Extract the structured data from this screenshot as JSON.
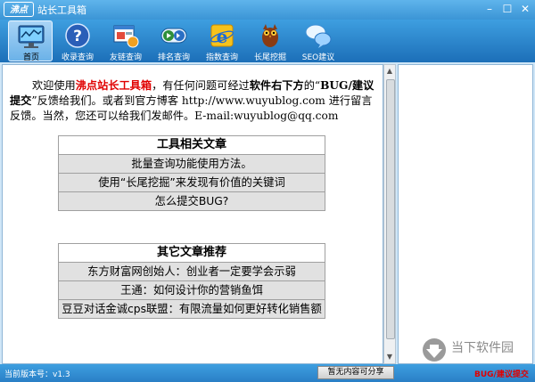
{
  "window": {
    "logo_text": "沸点",
    "title": "站长工具箱",
    "min_symbol": "–",
    "max_symbol": "☐",
    "close_symbol": "✕"
  },
  "toolbar": {
    "items": [
      {
        "label": "首页",
        "icon": "monitor-icon",
        "active": true
      },
      {
        "label": "收录查询",
        "icon": "help-icon",
        "active": false
      },
      {
        "label": "友链查询",
        "icon": "browser-window-icon",
        "active": false
      },
      {
        "label": "排名查询",
        "icon": "play-forward-icon",
        "active": false
      },
      {
        "label": "指数查询",
        "icon": "ie-icon",
        "active": false
      },
      {
        "label": "长尾挖掘",
        "icon": "owl-icon",
        "active": false
      },
      {
        "label": "SEO建议",
        "icon": "chat-bubbles-icon",
        "active": false
      }
    ]
  },
  "intro": {
    "p1": "欢迎使用",
    "brand": "沸点站长工具箱",
    "p2": "，有任何问题可经过",
    "bold1": "软件右下方",
    "p3": "的“",
    "bold2": "BUG/建议提交",
    "p4": "”反馈给我们。或者到官方博客 http://www.wuyublog.com 进行留言反馈。当然，您还可以给我们发邮件。E-mail:wuyublog@qq.com"
  },
  "tools_articles": {
    "heading": "工具相关文章",
    "items": [
      "批量查询功能使用方法。",
      "使用“长尾挖掘”来发现有价值的关键词",
      "怎么提交BUG?"
    ]
  },
  "other_articles": {
    "heading": "其它文章推荐",
    "items": [
      "东方财富网创始人：创业者一定要学会示弱",
      "王通：如何设计你的营销鱼饵",
      "豆豆对话金诚cps联盟：有限流量如何更好转化销售额"
    ]
  },
  "status": {
    "version": "当前版本号：v1.3",
    "share": "暂无内容可分享",
    "bug": "BUG/建议提交"
  },
  "watermark": {
    "text": "当下软件园"
  },
  "colors": {
    "accent": "#2a84d2",
    "brand_red": "#e00000"
  }
}
